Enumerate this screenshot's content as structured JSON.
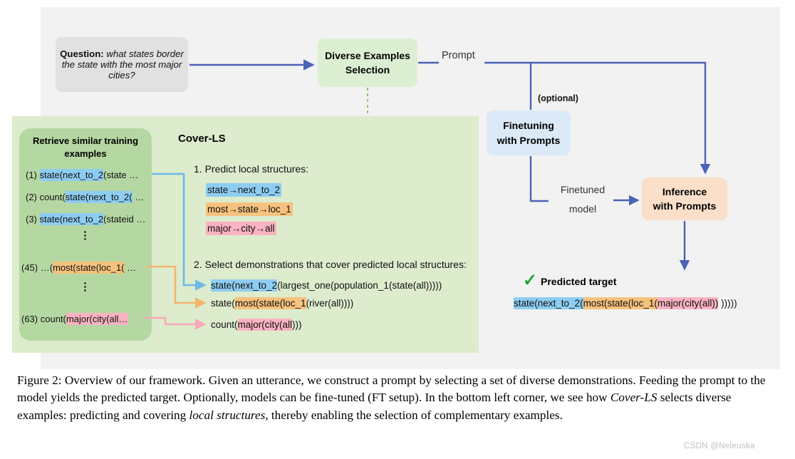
{
  "figure": {
    "question_box": {
      "label": "Question:",
      "text": "what states border the state with the most major cities?"
    },
    "diverse_examples": {
      "line1": "Diverse Examples",
      "line2": "Selection"
    },
    "prompt_label": "Prompt",
    "optional_label": "(optional)",
    "finetuning": {
      "line1": "Finetuning",
      "line2": "with Prompts"
    },
    "finetuned_model": {
      "line1": "Finetuned",
      "line2": "model"
    },
    "inference": {
      "line1": "Inference",
      "line2": "with Prompts"
    },
    "predicted_target_label": "Predicted target",
    "checkmark": "✓"
  },
  "retrieve_panel": {
    "title_line1": "Retrieve similar training",
    "title_line2": "examples",
    "examples": [
      {
        "num": "(1)",
        "pre": "",
        "hl": "state(next_to_2",
        "post": "(state …",
        "color": "blue"
      },
      {
        "num": "(2)",
        "pre": "count(",
        "hl": "state(next_to_2(",
        "post": " …",
        "color": "blue"
      },
      {
        "num": "(3)",
        "pre": "",
        "hl": "state(next_to_2",
        "post": "(stateid …",
        "color": "blue"
      },
      {
        "num": "(45)",
        "pre": "…(",
        "hl": "most(state(loc_1(",
        "post": " …",
        "color": "orange"
      },
      {
        "num": "(63)",
        "pre": "count(",
        "hl": "major(city(all…",
        "post": "",
        "color": "pink"
      }
    ],
    "ellipsis": "⋮"
  },
  "cover_ls": {
    "title": "Cover-LS",
    "step1_label": "1. Predict local structures:",
    "local_structures": [
      {
        "text": "state→next_to_2",
        "color": "blue"
      },
      {
        "text": "most→state→loc_1",
        "color": "orange"
      },
      {
        "text": "major→city→all",
        "color": "pink"
      }
    ],
    "step2_label": "2. Select demonstrations that cover predicted local structures:",
    "demonstrations": [
      {
        "pre": "",
        "hl": "state(next_to_2",
        "post": "(largest_one(population_1(state(all)))))",
        "color": "blue"
      },
      {
        "pre": "state(",
        "hl": "most(state(loc_1",
        "post": "(river(all))))",
        "color": "orange"
      },
      {
        "pre": "count(",
        "hl": "major(city(all",
        "post": ")))",
        "color": "pink"
      }
    ]
  },
  "predicted_target": {
    "part_blue": "state(next_to_2(",
    "part_orange": "most(state(loc_1(",
    "part_pink": "major(city(all))",
    "tail": " )))))"
  },
  "colors": {
    "blue_highlight": "#8ecdf2",
    "orange_highlight": "#f7c27e",
    "pink_highlight": "#fab3c0",
    "arrow_blue": "#4a63b5",
    "panel_green": "#dceccd",
    "box_green": "#b5d8a2",
    "box_blue": "#dce9f7",
    "box_peach": "#fbdfc9",
    "check_green": "#26a02c"
  },
  "caption": {
    "line1": "Figure 2:  Overview of our framework.  Given an utterance, we construct a prompt by selecting a set of diverse",
    "line2": "demonstrations. Feeding the prompt to the model yields the predicted target. Optionally, models can be fine-tuned",
    "line3_a": "(FT setup). In the bottom left corner, we see how ",
    "line3_i": "Cover-LS",
    "line3_b": " selects diverse examples: predicting and covering ",
    "line3_i2": "local",
    "line4_i": "structures",
    "line4_b": ", thereby enabling the selection of complementary examples."
  },
  "watermark": "CSDN @Neleuska"
}
